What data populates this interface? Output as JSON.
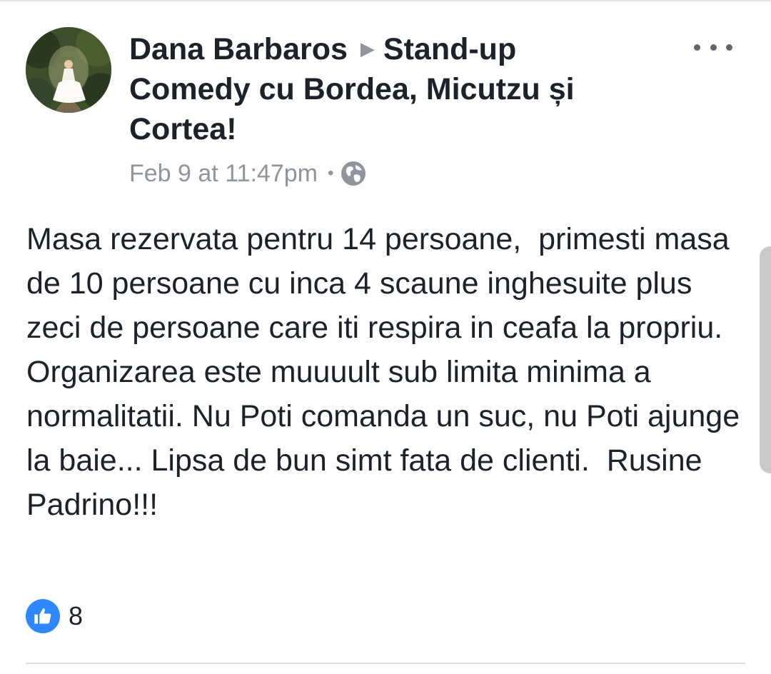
{
  "post": {
    "author": "Dana Barbaros",
    "target": "Stand-up Comedy cu Bordea, Micutzu și Cortea!",
    "timestamp": "Feb 9 at 11:47pm",
    "separator": "•",
    "privacy_icon": "globe-icon",
    "body": "Masa rezervata pentru 14 persoane,  primesti masa de 10 persoane cu inca 4 scaune inghesuite plus zeci de persoane care iti respira in ceafa la propriu.  Organizarea este muuuult sub limita minima a normalitatii. Nu Poti comanda un suc, nu Poti ajunge la baie... Lipsa de bun simt fata de clienti.  Rusine Padrino!!!"
  },
  "reactions": {
    "icon": "like-icon",
    "count": "8"
  },
  "colors": {
    "like_blue": "#2d88ff",
    "meta_gray": "#90949c",
    "text": "#1d2129"
  }
}
